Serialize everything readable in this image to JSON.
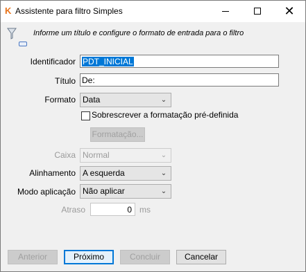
{
  "window": {
    "title": "Assistente para filtro Simples",
    "app_icon_glyph": "K",
    "minimize_icon": "minimize-icon",
    "maximize_icon": "maximize-icon",
    "close_icon": "close-icon",
    "close_glyph": "✕"
  },
  "header": {
    "info": "Informe um título e configure o formato de entrada para o filtro"
  },
  "form": {
    "identificador_label": "Identificador",
    "identificador_value": "PDT_INICIAL",
    "titulo_label": "Título",
    "titulo_value": "De:",
    "formato_label": "Formato",
    "formato_value": "Data",
    "override_label": "Sobrescrever a formatação pré-definida",
    "formatacao_button": "Formatação...",
    "caixa_label": "Caixa",
    "caixa_value": "Normal",
    "alinhamento_label": "Alinhamento",
    "alinhamento_value": "A esquerda",
    "modo_label": "Modo aplicação",
    "modo_value": "Não aplicar",
    "atraso_label": "Atraso",
    "atraso_value": "0",
    "atraso_unit": "ms",
    "dropdown_glyph": "⌄"
  },
  "buttons": {
    "anterior": "Anterior",
    "proximo": "Próximo",
    "concluir": "Concluir",
    "cancelar": "Cancelar"
  },
  "colors": {
    "accent": "#0078d7",
    "app_icon": "#e8731a"
  }
}
